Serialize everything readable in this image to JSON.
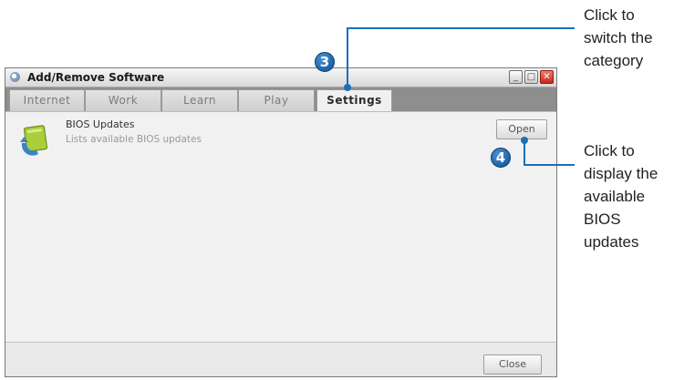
{
  "window": {
    "title": "Add/Remove Software",
    "controls": {
      "minimize": "_",
      "maximize": "□",
      "close": "✕"
    }
  },
  "tabs": [
    {
      "label": "Internet",
      "active": false
    },
    {
      "label": "Work",
      "active": false
    },
    {
      "label": "Learn",
      "active": false
    },
    {
      "label": "Play",
      "active": false
    },
    {
      "label": "Settings",
      "active": true
    }
  ],
  "items": [
    {
      "title": "BIOS Updates",
      "description": "Lists available BIOS updates",
      "icon": "bios-update-icon",
      "button": "Open"
    }
  ],
  "footer": {
    "close_label": "Close"
  },
  "annotations": {
    "badge3": "3",
    "badge4": "4",
    "callout3_lines": [
      "Click to",
      "switch the",
      "category"
    ],
    "callout4_lines": [
      "Click to",
      "display the",
      "available",
      "BIOS",
      "updates"
    ],
    "accent_color": "#1b6fb7"
  }
}
